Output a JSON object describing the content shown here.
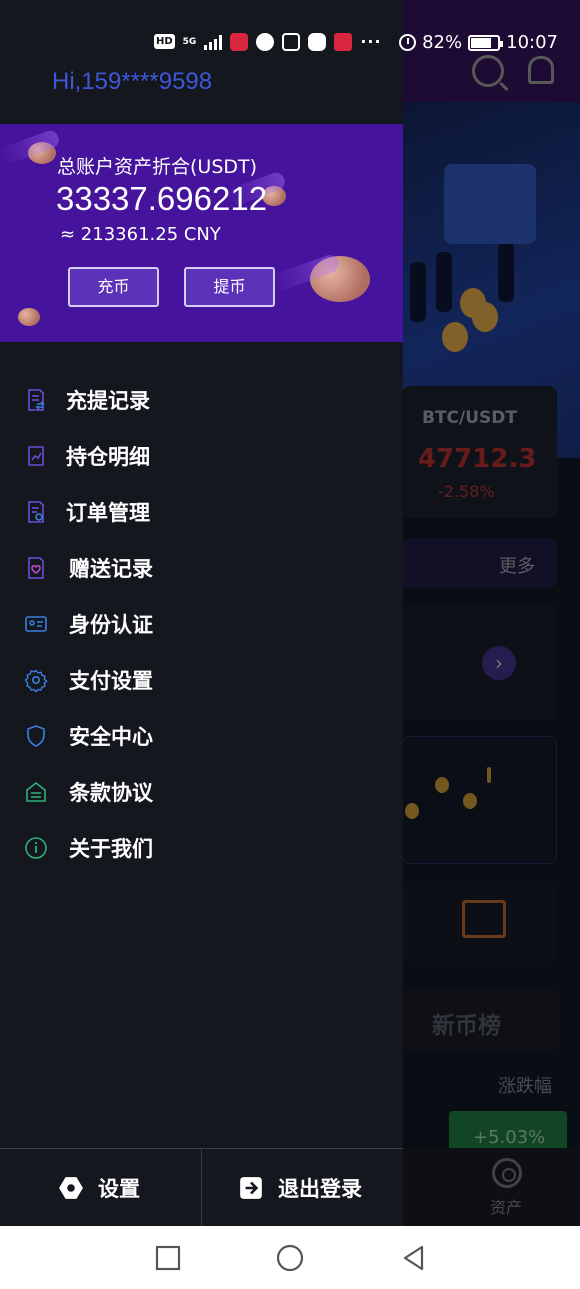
{
  "status_bar": {
    "left_chips": [
      "HD",
      "5G"
    ],
    "battery": "82%",
    "time": "10:07",
    "more": "···"
  },
  "background_app": {
    "btc_card": {
      "pair": "BTC/USDT",
      "price": "47712.3",
      "change": "-2.58%"
    },
    "more_label": "更多",
    "new_coin_tab": "新币榜",
    "change_label": "涨跌幅",
    "change_pill": "+5.03%",
    "tab_asset_label": "资产"
  },
  "drawer": {
    "greeting": "Hi,159****9598",
    "asset_card": {
      "title": "总账户资产折合(USDT)",
      "usdt_value": "33337.696212",
      "cny_value": "≈ 213361.25 CNY",
      "deposit_label": "充币",
      "withdraw_label": "提币"
    },
    "menu": [
      {
        "label": "充提记录",
        "icon": "deposit-record-icon",
        "color": "#6a4cd6"
      },
      {
        "label": "持仓明细",
        "icon": "position-detail-icon",
        "color": "#6a4cd6"
      },
      {
        "label": "订单管理",
        "icon": "order-icon",
        "color": "#6a4cd6"
      },
      {
        "label": "赠送记录",
        "icon": "gift-icon",
        "color": "#6a4cd6"
      },
      {
        "label": "身份认证",
        "icon": "id-card-icon",
        "color": "#3a7fe0"
      },
      {
        "label": "支付设置",
        "icon": "gear-icon",
        "color": "#3a7fe0"
      },
      {
        "label": "安全中心",
        "icon": "shield-icon",
        "color": "#3a7fe0"
      },
      {
        "label": "条款协议",
        "icon": "agreement-icon",
        "color": "#2fb07a"
      },
      {
        "label": "关于我们",
        "icon": "info-icon",
        "color": "#2fb07a"
      }
    ],
    "footer": {
      "settings_label": "设置",
      "logout_label": "退出登录"
    }
  },
  "colors": {
    "drawer_bg": "#15171e",
    "asset_card_bg": "#45139c",
    "greeting": "#3d57d8"
  }
}
